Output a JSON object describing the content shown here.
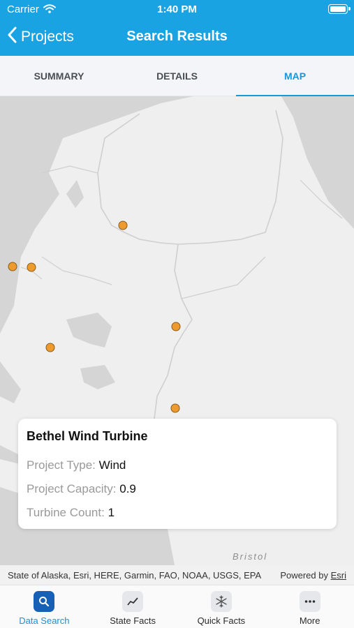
{
  "status_bar": {
    "carrier": "Carrier",
    "time": "1:40 PM"
  },
  "nav": {
    "back_label": "Projects",
    "title": "Search Results"
  },
  "tabs": [
    {
      "label": "SUMMARY",
      "active": false
    },
    {
      "label": "DETAILS",
      "active": false
    },
    {
      "label": "MAP",
      "active": true
    }
  ],
  "map": {
    "place_label": "Bristol",
    "pin_color": "#ee9b2e",
    "pin_count": 6
  },
  "popup": {
    "title": "Bethel Wind Turbine",
    "rows": [
      {
        "label": "Project Type:",
        "value": "Wind"
      },
      {
        "label": "Project Capacity:",
        "value": "0.9"
      },
      {
        "label": "Turbine Count:",
        "value": "1"
      }
    ]
  },
  "attribution": {
    "text": "State of Alaska, Esri, HERE, Garmin, FAO, NOAA, USGS, EPA",
    "powered_prefix": "Powered by",
    "powered_brand": "Esri"
  },
  "tabbar": [
    {
      "label": "Data Search",
      "icon": "search-icon",
      "active": true
    },
    {
      "label": "State Facts",
      "icon": "chart-icon",
      "active": false
    },
    {
      "label": "Quick Facts",
      "icon": "snowflake-icon",
      "active": false
    },
    {
      "label": "More",
      "icon": "more-icon",
      "active": false
    }
  ],
  "colors": {
    "header": "#1aa3e3",
    "accent": "#1a97d9",
    "active_tab_icon": "#1660b6"
  }
}
